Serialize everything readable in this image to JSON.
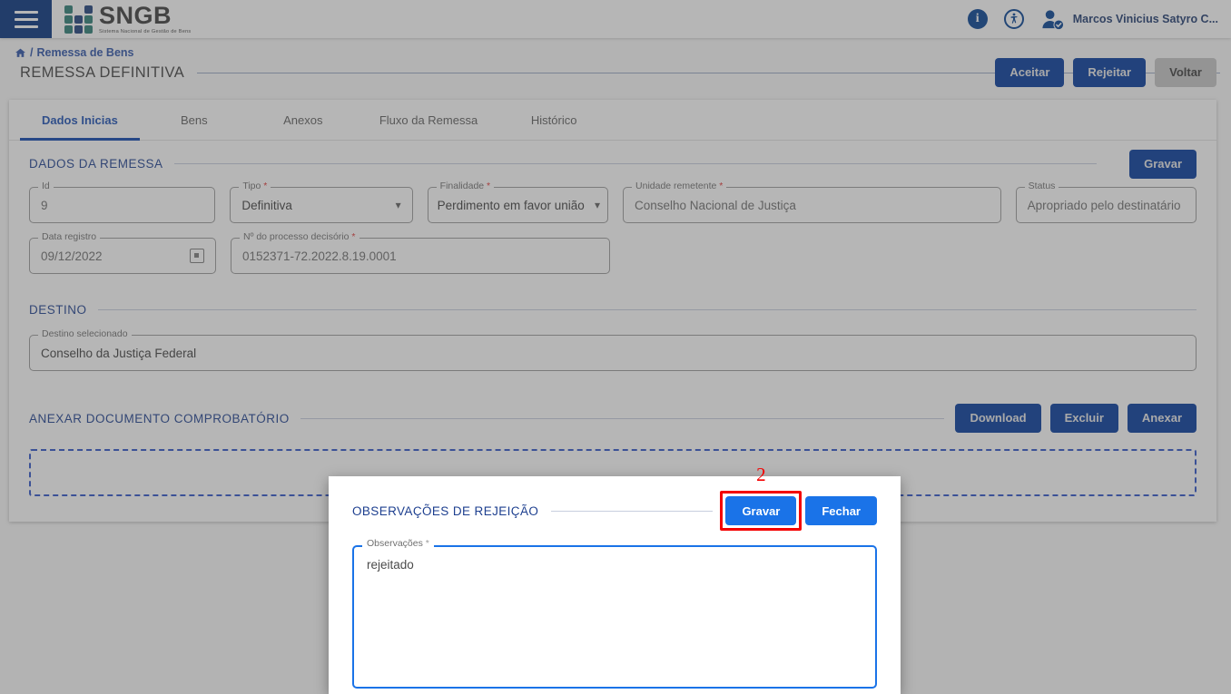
{
  "topbar": {
    "menu_icon": "hamburger-icon",
    "brand_title": "SNGB",
    "brand_subtitle": "Sistema Nacional de Gestão de Bens",
    "info_icon": "info-icon",
    "accessibility_icon": "accessibility-icon",
    "avatar_icon": "user-avatar-icon",
    "user_name": "Marcos Vinicius Satyro C..."
  },
  "breadcrumb": {
    "home_icon": "home-icon",
    "separator": "/",
    "current": "Remessa de Bens"
  },
  "header": {
    "page_title": "REMESSA DEFINITIVA",
    "actions": [
      {
        "label": "Aceitar",
        "style": "primary"
      },
      {
        "label": "Rejeitar",
        "style": "primary"
      },
      {
        "label": "Voltar",
        "style": "gray"
      }
    ]
  },
  "tabs": [
    {
      "label": "Dados Inicias",
      "active": true
    },
    {
      "label": "Bens",
      "active": false
    },
    {
      "label": "Anexos",
      "active": false
    },
    {
      "label": "Fluxo da Remessa",
      "active": false
    },
    {
      "label": "Histórico",
      "active": false
    }
  ],
  "dados_remessa": {
    "section_title": "DADOS DA REMESSA",
    "save_button": "Gravar",
    "fields": {
      "id": {
        "label": "Id",
        "value": "9",
        "required": false
      },
      "tipo": {
        "label": "Tipo",
        "value": "Definitiva",
        "required": true
      },
      "finalidade": {
        "label": "Finalidade",
        "value": "Perdimento em favor união",
        "required": true
      },
      "unidade_remetente": {
        "label": "Unidade remetente",
        "value": "Conselho Nacional de Justiça",
        "required": true
      },
      "status": {
        "label": "Status",
        "value": "Apropriado pelo destinatário",
        "required": false
      },
      "data_registro": {
        "label": "Data registro",
        "value": "09/12/2022",
        "required": false
      },
      "processo_decisorio": {
        "label": "Nº do processo decisório",
        "value": "0152371-72.2022.8.19.0001",
        "required": true
      }
    }
  },
  "destino": {
    "section_title": "DESTINO",
    "field": {
      "label": "Destino selecionado",
      "value": "Conselho da Justiça Federal"
    }
  },
  "anexar": {
    "section_title": "ANEXAR DOCUMENTO COMPROBATÓRIO",
    "actions": [
      {
        "label": "Download"
      },
      {
        "label": "Excluir"
      },
      {
        "label": "Anexar"
      }
    ],
    "dropzone_text": ""
  },
  "modal": {
    "title": "OBSERVAÇÕES DE REJEIÇÃO",
    "save_button": "Gravar",
    "close_button": "Fechar",
    "annotation_number": "2",
    "textarea": {
      "label": "Observações",
      "required_mark": "*",
      "value": "rejeitado"
    }
  },
  "colors": {
    "brand_dark_blue": "#00307d",
    "primary_button": "#00379c",
    "modal_button": "#1a73e8",
    "section_title": "#1d3f8f",
    "highlight_red": "#f40000",
    "required_red": "#e03131",
    "dropzone_border": "#2b52c9"
  }
}
